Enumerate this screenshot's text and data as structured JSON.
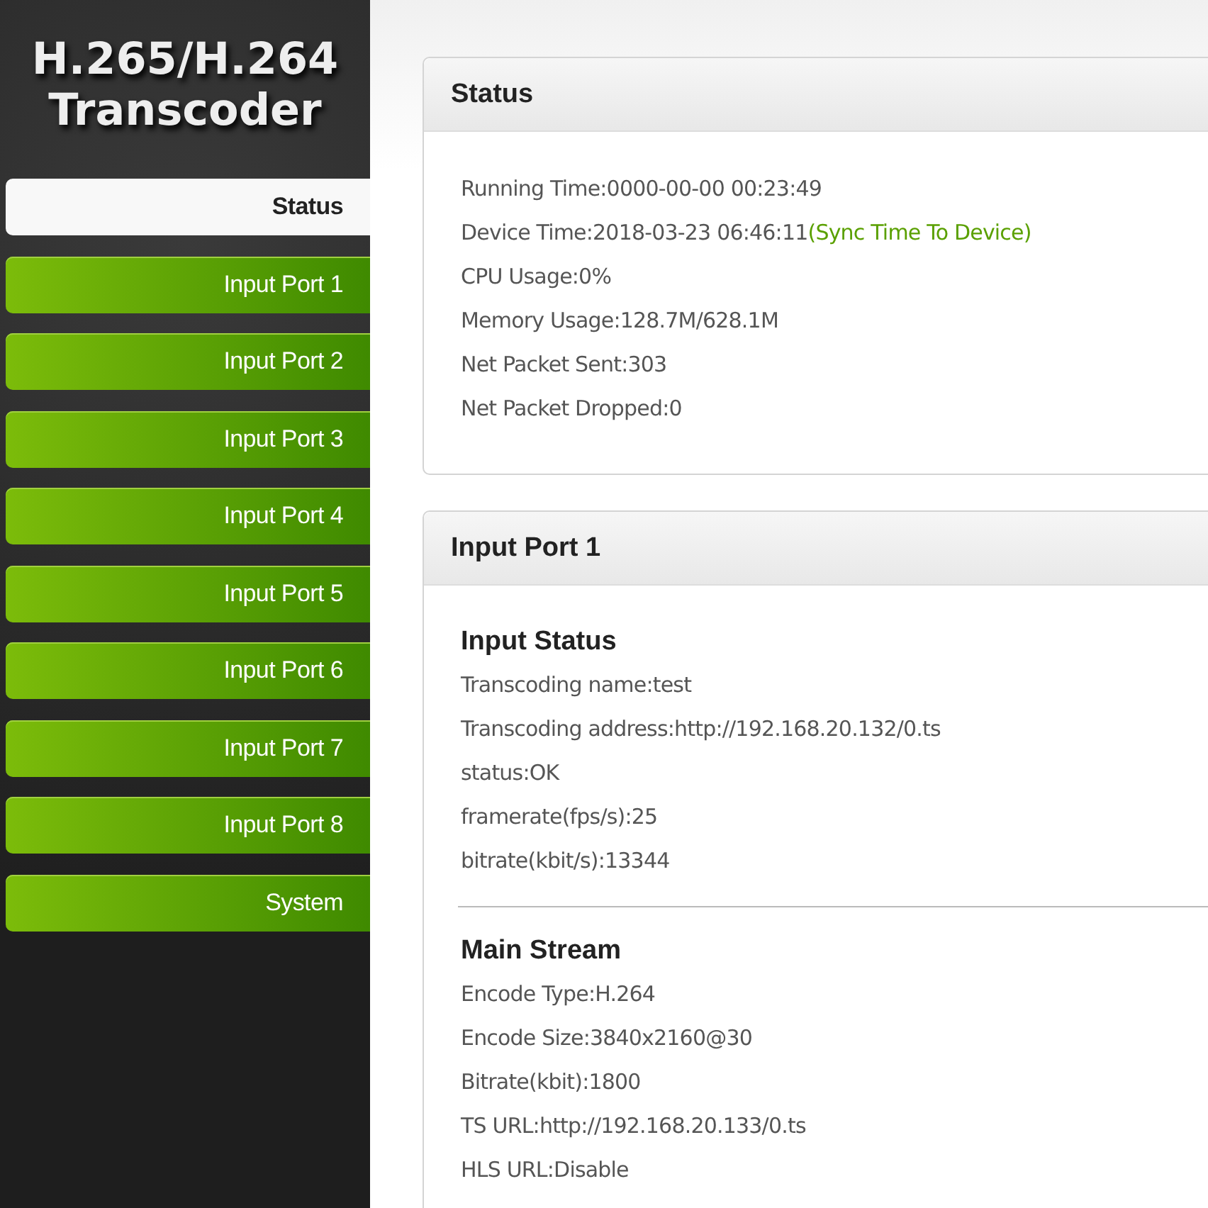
{
  "logo": {
    "lines": [
      "H.265/H.264",
      "Transcoder"
    ]
  },
  "nav": [
    {
      "label": "Status",
      "selected": true
    },
    {
      "label": "Input Port 1",
      "selected": false
    },
    {
      "label": "Input Port 2",
      "selected": false
    },
    {
      "label": "Input Port 3",
      "selected": false
    },
    {
      "label": "Input Port 4",
      "selected": false
    },
    {
      "label": "Input Port 5",
      "selected": false
    },
    {
      "label": "Input Port 6",
      "selected": false
    },
    {
      "label": "Input Port 7",
      "selected": false
    },
    {
      "label": "Input Port 8",
      "selected": false
    },
    {
      "label": "System",
      "selected": false
    }
  ],
  "panels": [
    {
      "title": "Status",
      "sections": [
        {
          "lines": [
            {
              "text": "Running Time:0000-00-00 00:23:49"
            },
            {
              "text": "Device Time:2018-03-23 06:46:11",
              "link": "(Sync Time To Device)"
            },
            {
              "text": "CPU Usage:0%"
            },
            {
              "text": "Memory Usage:128.7M/628.1M"
            },
            {
              "text": "Net Packet Sent:303"
            },
            {
              "text": "Net Packet Dropped:0"
            }
          ]
        }
      ]
    },
    {
      "title": "Input Port 1",
      "sections": [
        {
          "heading": "Input Status",
          "lines": [
            {
              "text": "Transcoding name:test"
            },
            {
              "text": "Transcoding address:http://192.168.20.132/0.ts"
            },
            {
              "text": "status:OK"
            },
            {
              "text": "framerate(fps/s):25"
            },
            {
              "text": "bitrate(kbit/s):13344"
            }
          ]
        },
        {
          "heading": "Main Stream",
          "lines": [
            {
              "text": "Encode Type:H.264"
            },
            {
              "text": "Encode Size:3840x2160@30"
            },
            {
              "text": "Bitrate(kbit):1800"
            },
            {
              "text": "TS URL:http://192.168.20.133/0.ts"
            },
            {
              "text": "HLS URL:Disable"
            }
          ]
        }
      ]
    }
  ]
}
